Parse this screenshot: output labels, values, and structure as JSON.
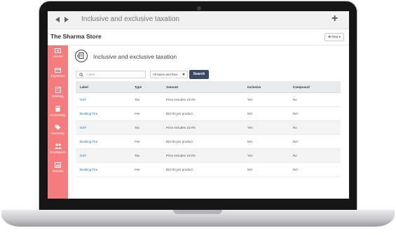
{
  "browser": {
    "title": "Inclusive and exclusive taxation",
    "plus_label": "+"
  },
  "header": {
    "store_name": "The Sharma Store",
    "new_button_label": "✚ New ▾"
  },
  "sidebar": {
    "items": [
      {
        "label": "Income",
        "icon": "income-icon"
      },
      {
        "label": "Expenses",
        "icon": "expenses-icon"
      },
      {
        "label": "Banking",
        "icon": "banking-icon"
      },
      {
        "label": "Accounting",
        "icon": "accounting-icon"
      },
      {
        "label": "Inventory",
        "icon": "inventory-icon"
      },
      {
        "label": "Employees",
        "icon": "employees-icon"
      },
      {
        "label": "Reports",
        "icon": "reports-icon"
      }
    ]
  },
  "main": {
    "title": "Inclusive and exclusive taxation",
    "search_placeholder": "Label...",
    "filter_value": "All taxes and fees",
    "search_button": "Search",
    "columns": [
      "Label",
      "Type",
      "Amount",
      "Inclusive",
      "Compound"
    ],
    "rows": [
      [
        "GST",
        "Tax",
        "Price includes 10.0%",
        "Yes",
        "No"
      ],
      [
        "Booking Fee",
        "Fee",
        "$10.00 per product",
        "N/A",
        "N/A"
      ],
      [
        "GST",
        "Tax",
        "Price includes 10.0%",
        "Yes",
        "No"
      ],
      [
        "Booking Fee",
        "Fee",
        "$10.00 per product",
        "N/A",
        "N/A"
      ],
      [
        "GST",
        "Tax",
        "Price includes 10.0%",
        "Yes",
        "No"
      ],
      [
        "Booking Fee",
        "Fee",
        "$10.00 per product",
        "N/A",
        "N/A"
      ]
    ]
  },
  "colors": {
    "sidebar": "#f47c7c",
    "search_button": "#3b4a63",
    "link": "#1f6fb5"
  }
}
